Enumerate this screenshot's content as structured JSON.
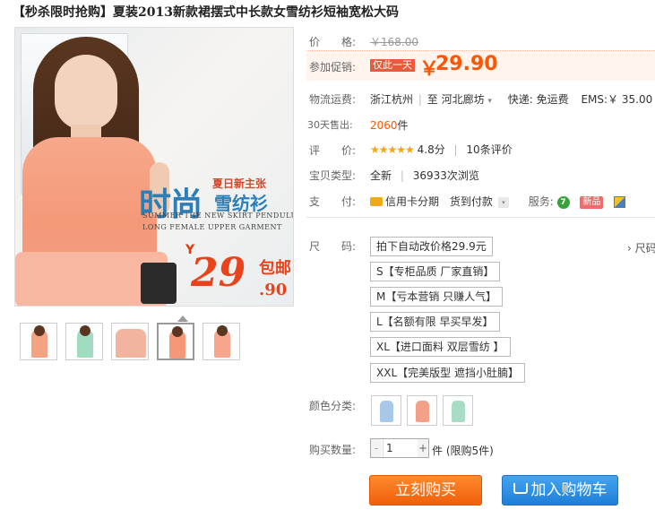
{
  "title": "【秒杀限时抢购】夏装2013新款裙摆式中长款女雪纺衫短袖宽松大码",
  "image": {
    "slogan_small": "夏日新主张",
    "slogan_big": "时尚",
    "slogan_mid": "雪纺衫",
    "line1": "SUMMER THE NEW SKIRT PENDULUM",
    "line2": "LONG FEMALE UPPER GARMENT",
    "yen": "Y",
    "price": "29",
    "price_dec": ".90",
    "baoyou": "包邮"
  },
  "thumbnails": [
    {
      "color": "#f4a184"
    },
    {
      "color": "#9fdcc0"
    },
    {
      "color": "#f2b39f"
    },
    {
      "color": "#f49879",
      "selected": true
    },
    {
      "color": "#f6a68d"
    }
  ],
  "price": {
    "label": "价　　格:",
    "original": "￥168.00"
  },
  "promo": {
    "label": "参加促销:",
    "tag": "仅此一天",
    "yen": "￥",
    "price": "29.90"
  },
  "shipping": {
    "label": "物流运费:",
    "from": "浙江杭州",
    "to_prefix": "至",
    "to": "河北廊坊",
    "dropdown": "▾",
    "express": "快递: 免运费",
    "ems": "EMS:￥ 35.00"
  },
  "sales": {
    "label": "30天售出:",
    "count": "2060",
    "unit": "件"
  },
  "rating": {
    "label": "评　　价:",
    "stars": "★★★★★",
    "score": "4.8分",
    "sep": "|",
    "reviews": "10条评价"
  },
  "item_type": {
    "label": "宝贝类型:",
    "condition": "全新",
    "sep": "|",
    "views": "36933次浏览"
  },
  "payment": {
    "label": "支　　付:",
    "credit": "信用卡分期",
    "cod": "货到付款",
    "dropdown": "▾",
    "service_label": "服务:",
    "service_7": "7",
    "service_new": "新品"
  },
  "size": {
    "label": "尺　　码:",
    "more": "› 尺码",
    "options": [
      "拍下自动改价格29.9元",
      "S【专柜品质 厂家直销】",
      "M【亏本营销 只赚人气】",
      "L【名额有限 早买早发】",
      "XL【进口面料 双层雪纺 】",
      "XXL【完美版型 遮挡小肚腩】"
    ]
  },
  "color": {
    "label": "颜色分类:",
    "swatches": [
      "#a8c8ea",
      "#f2a08a",
      "#a8dcc4"
    ]
  },
  "quantity": {
    "label": "购买数量:",
    "minus": "-",
    "value": "1",
    "plus": "+",
    "unit": "件 (限购5件)"
  },
  "actions": {
    "buy_now": "立刻购买",
    "add_cart": "加入购物车"
  }
}
